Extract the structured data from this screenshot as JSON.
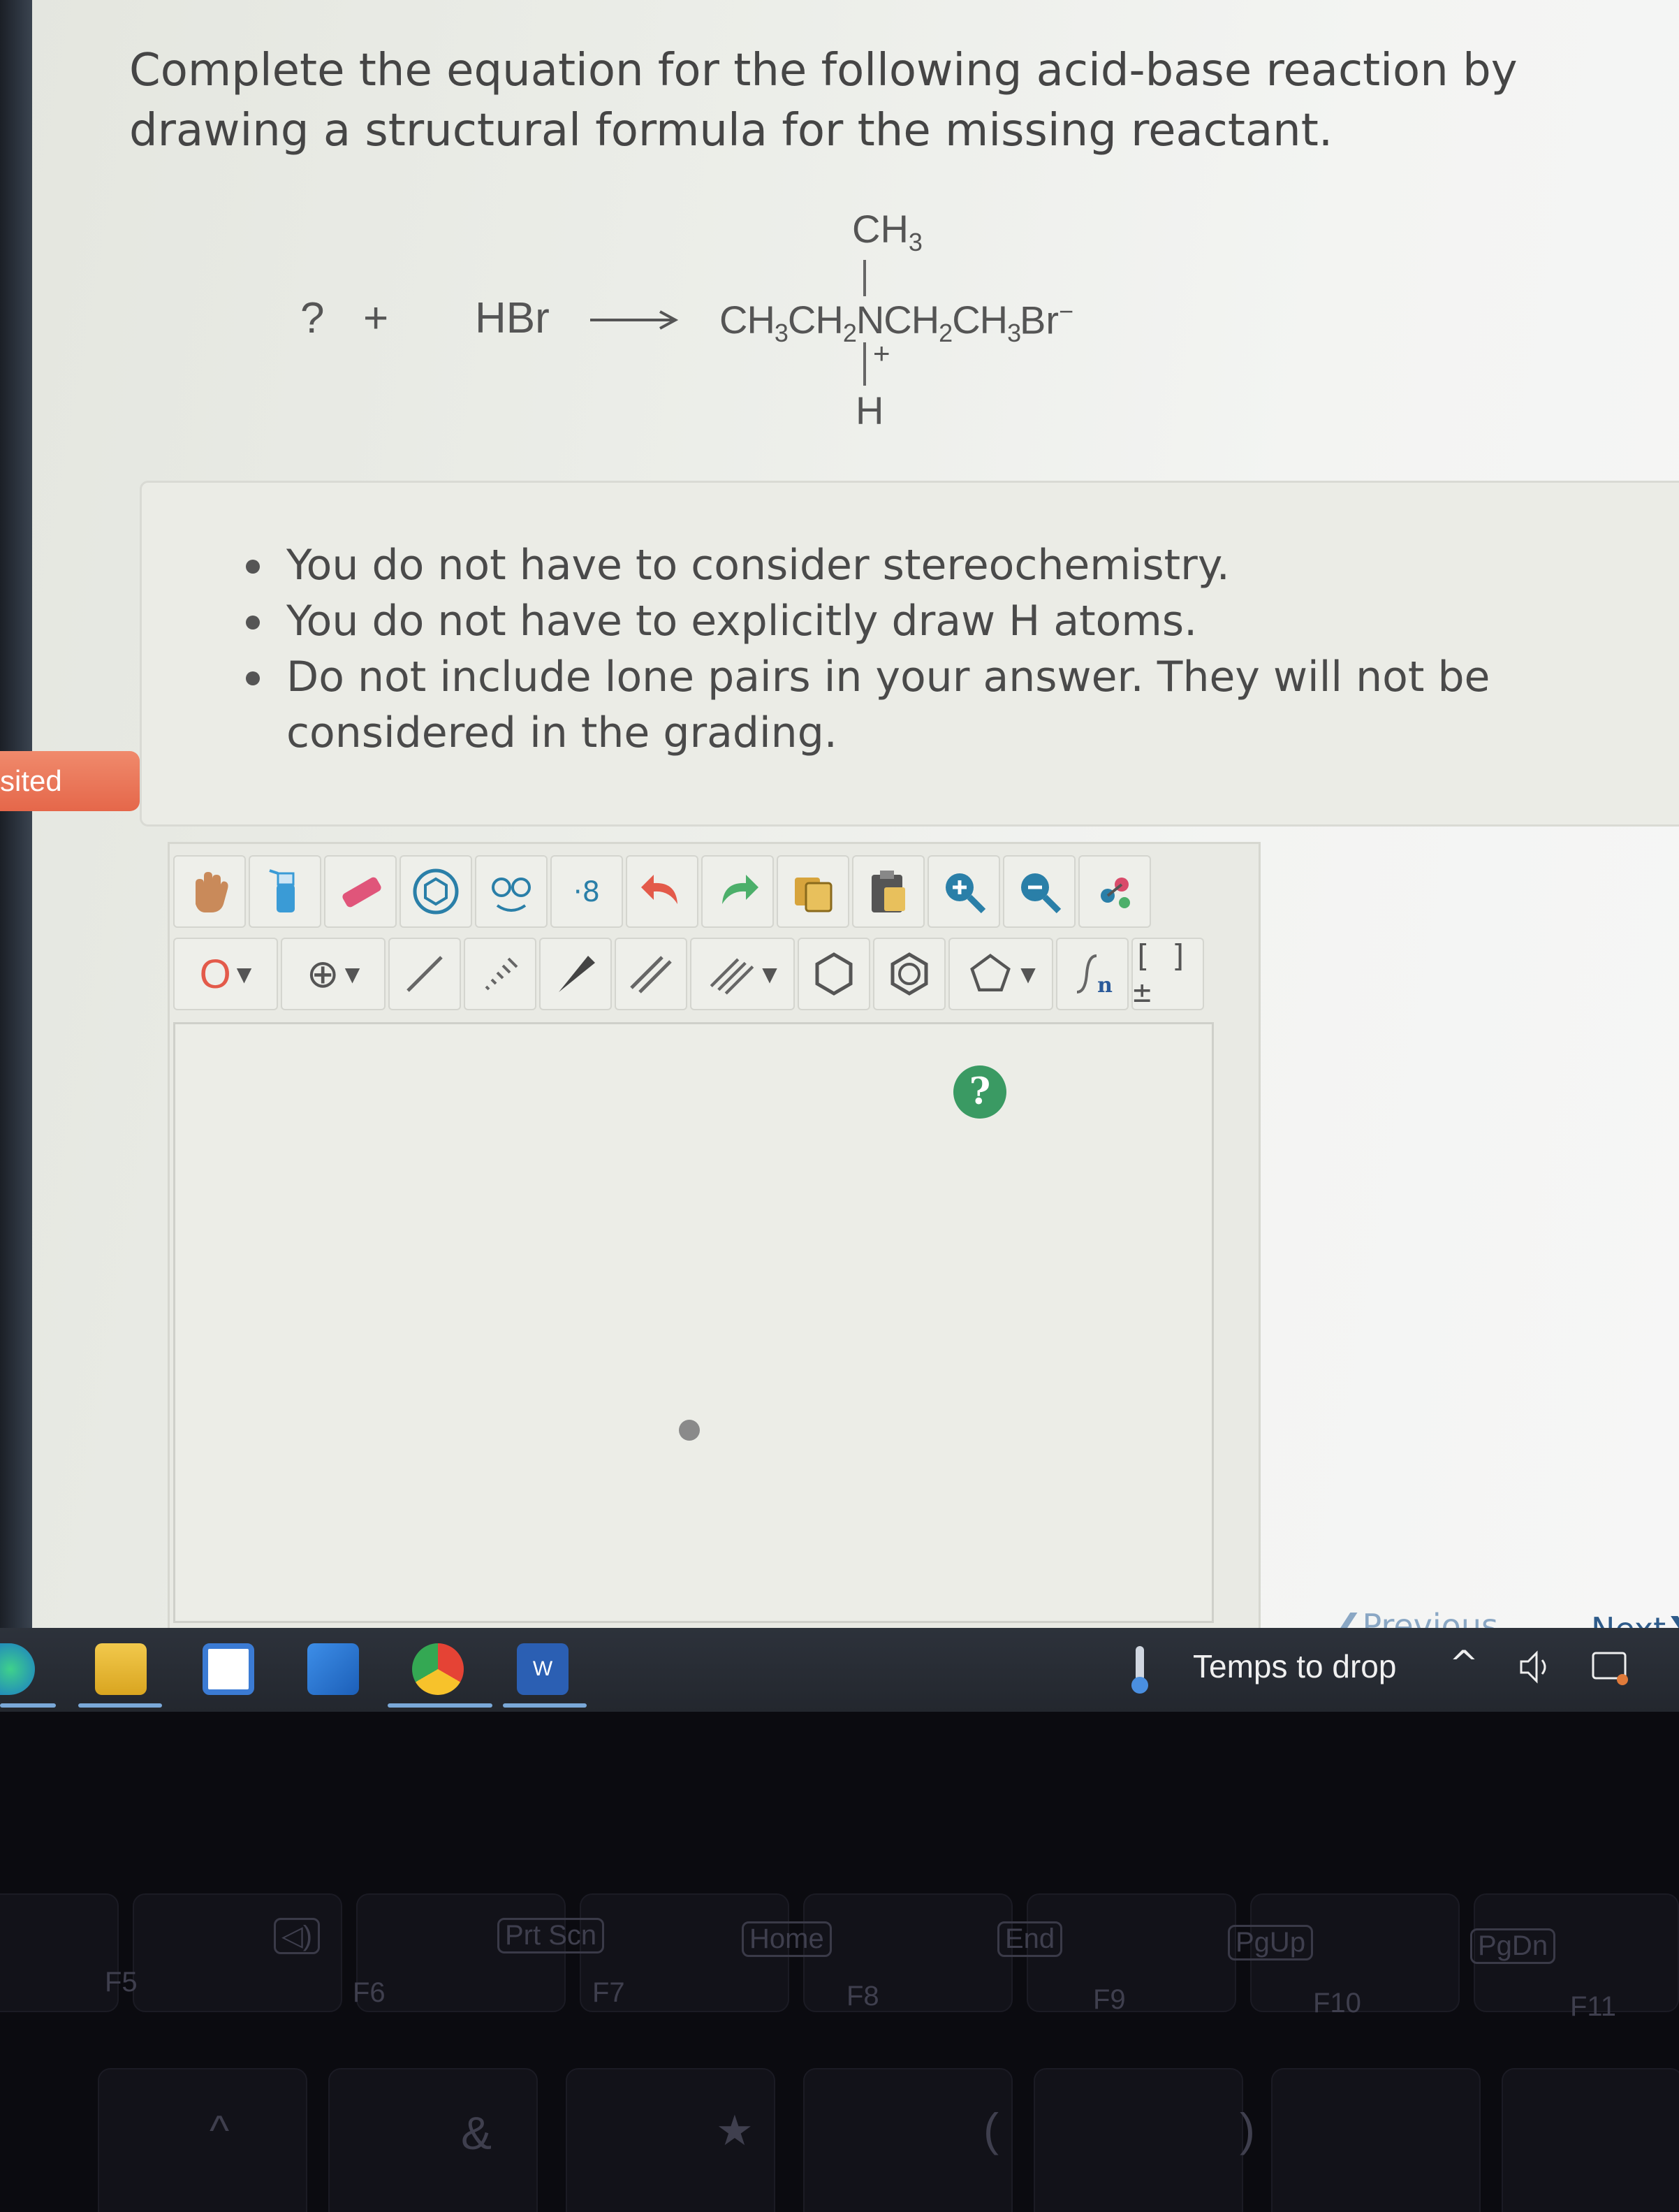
{
  "sidebar": {
    "visited_label": "sited"
  },
  "question": {
    "prompt": "Complete the equation for the following acid-base reaction by drawing a structural formula for the missing reactant."
  },
  "equation": {
    "missing": "?",
    "plus": "+",
    "reagent": "HBr",
    "product_top": "CH3",
    "product_main": "CH3CH2NCH2CH3",
    "product_charge": "+",
    "product_bottom": "H",
    "counterion": "Br−"
  },
  "hints": [
    "You do not have to consider stereochemistry.",
    "You do not have to explicitly draw H atoms.",
    "Do not include lone pairs in your answer. They will not be considered in the grading."
  ],
  "editor": {
    "row1_tools": [
      "hand-tool",
      "clear-tool",
      "eraser-tool",
      "template-tool",
      "chain-tool",
      "ring-number-tool",
      "undo-tool",
      "redo-tool",
      "copy-tool",
      "paste-tool",
      "zoom-in-tool",
      "zoom-out-tool",
      "clean-tool"
    ],
    "atom_selector": "O",
    "charge_selector": "⊕",
    "bracket_label": "[ ]±",
    "sgroup_label": "n",
    "help_label": "?"
  },
  "nav": {
    "previous": "Previous",
    "next": "Next"
  },
  "taskbar": {
    "weather": "Temps to drop",
    "word_label": "W"
  },
  "keyboard": {
    "f5": "F5",
    "f6": "F6",
    "f7": "F7",
    "f8": "F8",
    "f9": "F9",
    "f10": "F10",
    "f11": "F11",
    "prtscn": "Prt Scn",
    "home": "Home",
    "end": "End",
    "pgup": "PgUp",
    "pgdn": "PgDn",
    "amp": "&",
    "star": "★",
    "paren_open": "(",
    "paren_close": ")",
    "caret": "^"
  },
  "colors": {
    "visited": "#e5674a",
    "help": "#3a9a63",
    "taskbar": "#2d323b"
  }
}
